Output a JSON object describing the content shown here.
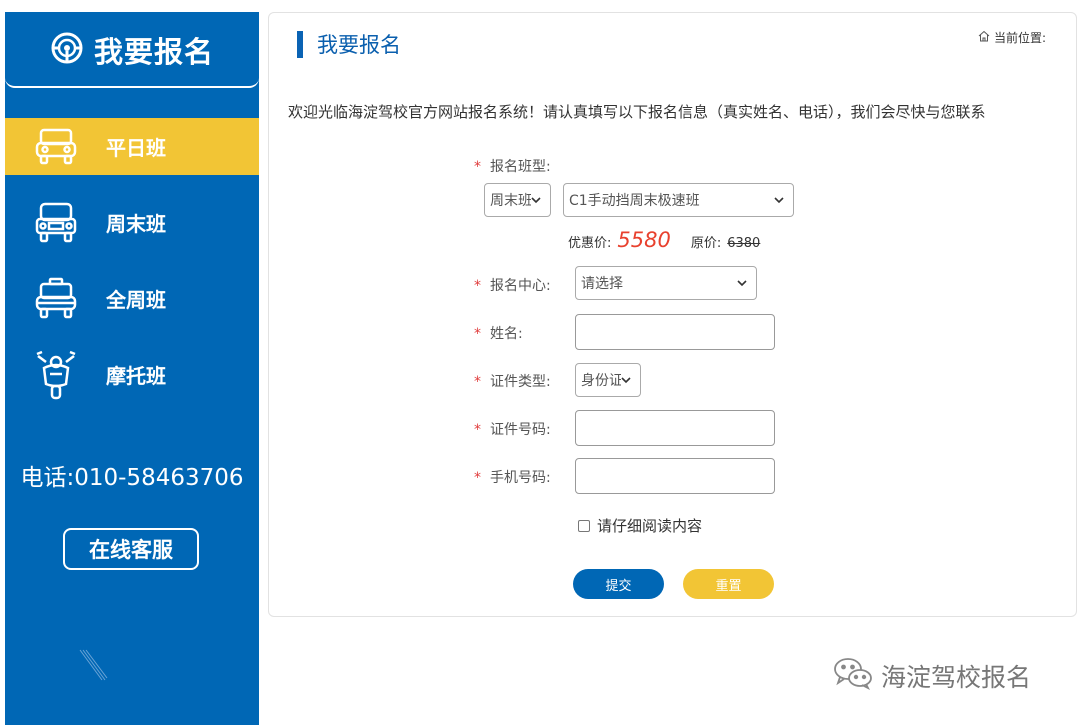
{
  "sidebar": {
    "brand_title": "我要报名",
    "nav": [
      {
        "label": "平日班",
        "icon": "car-front-icon",
        "active": true
      },
      {
        "label": "周末班",
        "icon": "truck-front-icon",
        "active": false
      },
      {
        "label": "全周班",
        "icon": "taxi-front-icon",
        "active": false
      },
      {
        "label": "摩托班",
        "icon": "motorcycle-icon",
        "active": false
      }
    ],
    "phone": "电话:010-58463706",
    "service_button": "在线客服"
  },
  "panel": {
    "title": "我要报名",
    "breadcrumb": "当前位置:",
    "intro": "欢迎光临海淀驾校官方网站报名系统！请认真填写以下报名信息（真实姓名、电话），我们会尽快与您联系",
    "form": {
      "required_mark": "*",
      "class_type_label": "报名班型:",
      "class_category_value": "周末班",
      "class_detail_value": "C1手动挡周末极速班",
      "sale_price_label": "优惠价:",
      "sale_price": "5580",
      "original_price_label": "原价:",
      "original_price": "6380",
      "center_label": "报名中心:",
      "center_value": "请选择",
      "name_label": "姓名:",
      "id_type_label": "证件类型:",
      "id_type_value": "身份证",
      "id_number_label": "证件号码:",
      "mobile_label": "手机号码:",
      "agree_label": "请仔细阅读内容",
      "submit_label": "提交",
      "reset_label": "重置"
    }
  },
  "watermark": "海淀驾校报名",
  "colors": {
    "primary": "#0067b5",
    "accent": "#f2c535",
    "required": "#e03b3b",
    "price": "#e8412e"
  }
}
